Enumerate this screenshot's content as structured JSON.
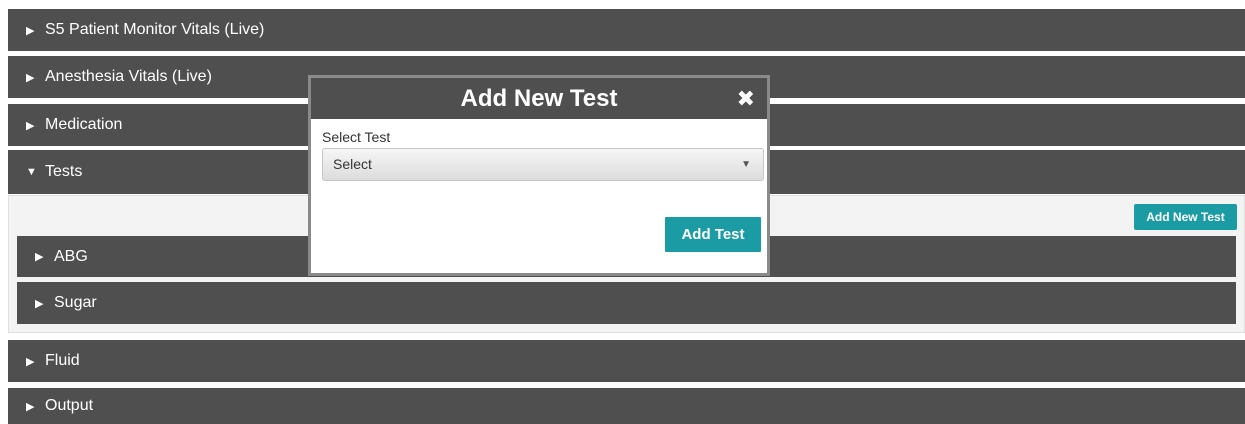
{
  "panels": [
    {
      "label": "S5 Patient Monitor Vitals (Live)",
      "arrow": "▶"
    },
    {
      "label": "Anesthesia Vitals (Live)",
      "arrow": "▶"
    },
    {
      "label": "Medication",
      "arrow": "▶"
    },
    {
      "label": "Tests",
      "arrow": "▼"
    },
    {
      "label": "Fluid",
      "arrow": "▶"
    },
    {
      "label": "Output",
      "arrow": "▶"
    }
  ],
  "tests": {
    "add_new_test_label": "Add New Test",
    "subpanels": [
      {
        "label": "ABG",
        "arrow": "▶"
      },
      {
        "label": "Sugar",
        "arrow": "▶"
      }
    ]
  },
  "modal": {
    "title": "Add New Test",
    "close_glyph": "✖",
    "select_label": "Select Test",
    "select_value": "Select",
    "select_caret": "▼",
    "add_button": "Add Test"
  },
  "colors": {
    "panel_bg": "#4f4f4f",
    "accent": "#1b9ba3"
  }
}
